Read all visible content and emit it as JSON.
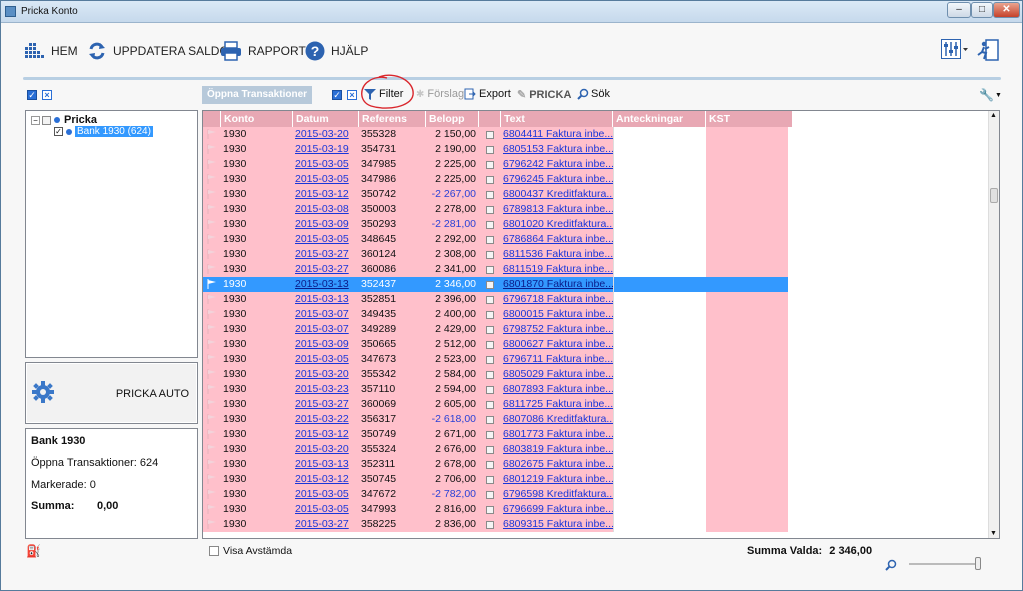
{
  "window": {
    "title": "Pricka Konto",
    "minimize": "–",
    "maximize": "□",
    "close": "✕"
  },
  "toolbar": {
    "home": "HEM",
    "refresh": "UPPDATERA SALDO",
    "report": "RAPPORT",
    "help": "HJÄLP"
  },
  "subbar": {
    "open_tx": "Öppna Transaktioner",
    "filter": "Filter",
    "suggest": "Förslag",
    "export": "Export",
    "pricka": "PRICKA",
    "search": "Sök"
  },
  "tree": {
    "root": "Pricka",
    "child": "Bank 1930 (624)"
  },
  "auto": {
    "label": "PRICKA AUTO"
  },
  "info": {
    "title": "Bank 1930",
    "open_label": "Öppna Transaktioner: 624",
    "marked_label": "Markerade: 0",
    "sum_label": "Summa:",
    "sum_value": "0,00"
  },
  "grid": {
    "columns": [
      "Konto",
      "Datum",
      "Referens",
      "Belopp",
      "",
      "Text",
      "Anteckningar",
      "KST"
    ],
    "rows": [
      [
        "1930",
        "2015-03-20",
        "355328",
        "2 150,00",
        "6804411 Faktura inbe..."
      ],
      [
        "1930",
        "2015-03-19",
        "354731",
        "2 190,00",
        "6805153 Faktura inbe..."
      ],
      [
        "1930",
        "2015-03-05",
        "347985",
        "2 225,00",
        "6796242 Faktura inbe..."
      ],
      [
        "1930",
        "2015-03-05",
        "347986",
        "2 225,00",
        "6796245 Faktura inbe..."
      ],
      [
        "1930",
        "2015-03-12",
        "350742",
        "-2 267,00",
        "6800437 Kreditfaktura..."
      ],
      [
        "1930",
        "2015-03-08",
        "350003",
        "2 278,00",
        "6789813 Faktura inbe..."
      ],
      [
        "1930",
        "2015-03-09",
        "350293",
        "-2 281,00",
        "6801020 Kreditfaktura..."
      ],
      [
        "1930",
        "2015-03-05",
        "348645",
        "2 292,00",
        "6786864 Faktura inbe..."
      ],
      [
        "1930",
        "2015-03-27",
        "360124",
        "2 308,00",
        "6811536 Faktura inbe..."
      ],
      [
        "1930",
        "2015-03-27",
        "360086",
        "2 341,00",
        "6811519 Faktura inbe..."
      ],
      [
        "1930",
        "2015-03-13",
        "352437",
        "2 346,00",
        "6801870 Faktura inbe..."
      ],
      [
        "1930",
        "2015-03-13",
        "352851",
        "2 396,00",
        "6796718 Faktura inbe..."
      ],
      [
        "1930",
        "2015-03-07",
        "349435",
        "2 400,00",
        "6800015 Faktura inbe..."
      ],
      [
        "1930",
        "2015-03-07",
        "349289",
        "2 429,00",
        "6798752 Faktura inbe..."
      ],
      [
        "1930",
        "2015-03-09",
        "350665",
        "2 512,00",
        "6800627 Faktura inbe..."
      ],
      [
        "1930",
        "2015-03-05",
        "347673",
        "2 523,00",
        "6796711 Faktura inbe..."
      ],
      [
        "1930",
        "2015-03-20",
        "355342",
        "2 584,00",
        "6805029 Faktura inbe..."
      ],
      [
        "1930",
        "2015-03-23",
        "357110",
        "2 594,00",
        "6807893 Faktura inbe..."
      ],
      [
        "1930",
        "2015-03-27",
        "360069",
        "2 605,00",
        "6811725 Faktura inbe..."
      ],
      [
        "1930",
        "2015-03-22",
        "356317",
        "-2 618,00",
        "6807086 Kreditfaktura..."
      ],
      [
        "1930",
        "2015-03-12",
        "350749",
        "2 671,00",
        "6801773 Faktura inbe..."
      ],
      [
        "1930",
        "2015-03-20",
        "355324",
        "2 676,00",
        "6803819 Faktura inbe..."
      ],
      [
        "1930",
        "2015-03-13",
        "352311",
        "2 678,00",
        "6802675 Faktura inbe..."
      ],
      [
        "1930",
        "2015-03-12",
        "350745",
        "2 706,00",
        "6801219 Faktura inbe..."
      ],
      [
        "1930",
        "2015-03-05",
        "347672",
        "-2 782,00",
        "6796598 Kreditfaktura..."
      ],
      [
        "1930",
        "2015-03-05",
        "347993",
        "2 816,00",
        "6796699 Faktura inbe..."
      ],
      [
        "1930",
        "2015-03-27",
        "358225",
        "2 836,00",
        "6809315 Faktura inbe..."
      ]
    ],
    "selected_index": 10
  },
  "bottom": {
    "show_reconciled": "Visa Avstämda",
    "sum_selected_label": "Summa Valda:",
    "sum_selected_value": "2 346,00",
    "zoom_level": 1.0
  },
  "colors": {
    "row_bg": "#ffc0cb",
    "header_bg": "#e8a8b4",
    "selected": "#3399ff",
    "link": "#1a36d9",
    "annotation_circle": "#d9262c"
  }
}
